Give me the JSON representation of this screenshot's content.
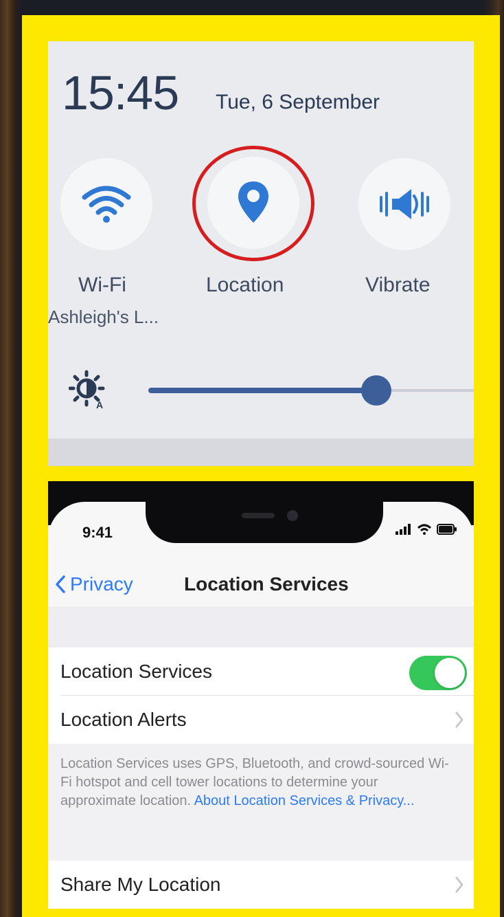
{
  "colors": {
    "frame": "#ffe800",
    "highlight": "#d61e1e",
    "accent_android": "#3c5f9a",
    "accent_ios": "#2d7bf6",
    "toggle_on": "#35c759"
  },
  "quick_settings": {
    "time": "15:45",
    "date": "Tue, 6 September",
    "tiles": [
      {
        "icon": "wifi-icon",
        "label": "Wi-Fi",
        "sub": "Ashleigh's L..."
      },
      {
        "icon": "location-pin-icon",
        "label": "Location",
        "sub": ""
      },
      {
        "icon": "vibrate-icon",
        "label": "Vibrate",
        "sub": ""
      }
    ],
    "brightness": {
      "icon": "brightness-auto-icon",
      "level": 0.7
    }
  },
  "ios": {
    "status": {
      "time": "9:41",
      "icons": [
        "signal-icon",
        "wifi-icon",
        "battery-icon"
      ]
    },
    "nav": {
      "back_label": "Privacy",
      "title": "Location Services"
    },
    "rows": {
      "location_services": "Location Services",
      "location_alerts": "Location Alerts",
      "share_my_location": "Share My Location"
    },
    "footer_text": "Location Services uses GPS, Bluetooth, and crowd-sourced Wi-Fi hotspot and cell tower locations to determine your approximate location.",
    "footer_link": "About Location Services & Privacy..."
  }
}
